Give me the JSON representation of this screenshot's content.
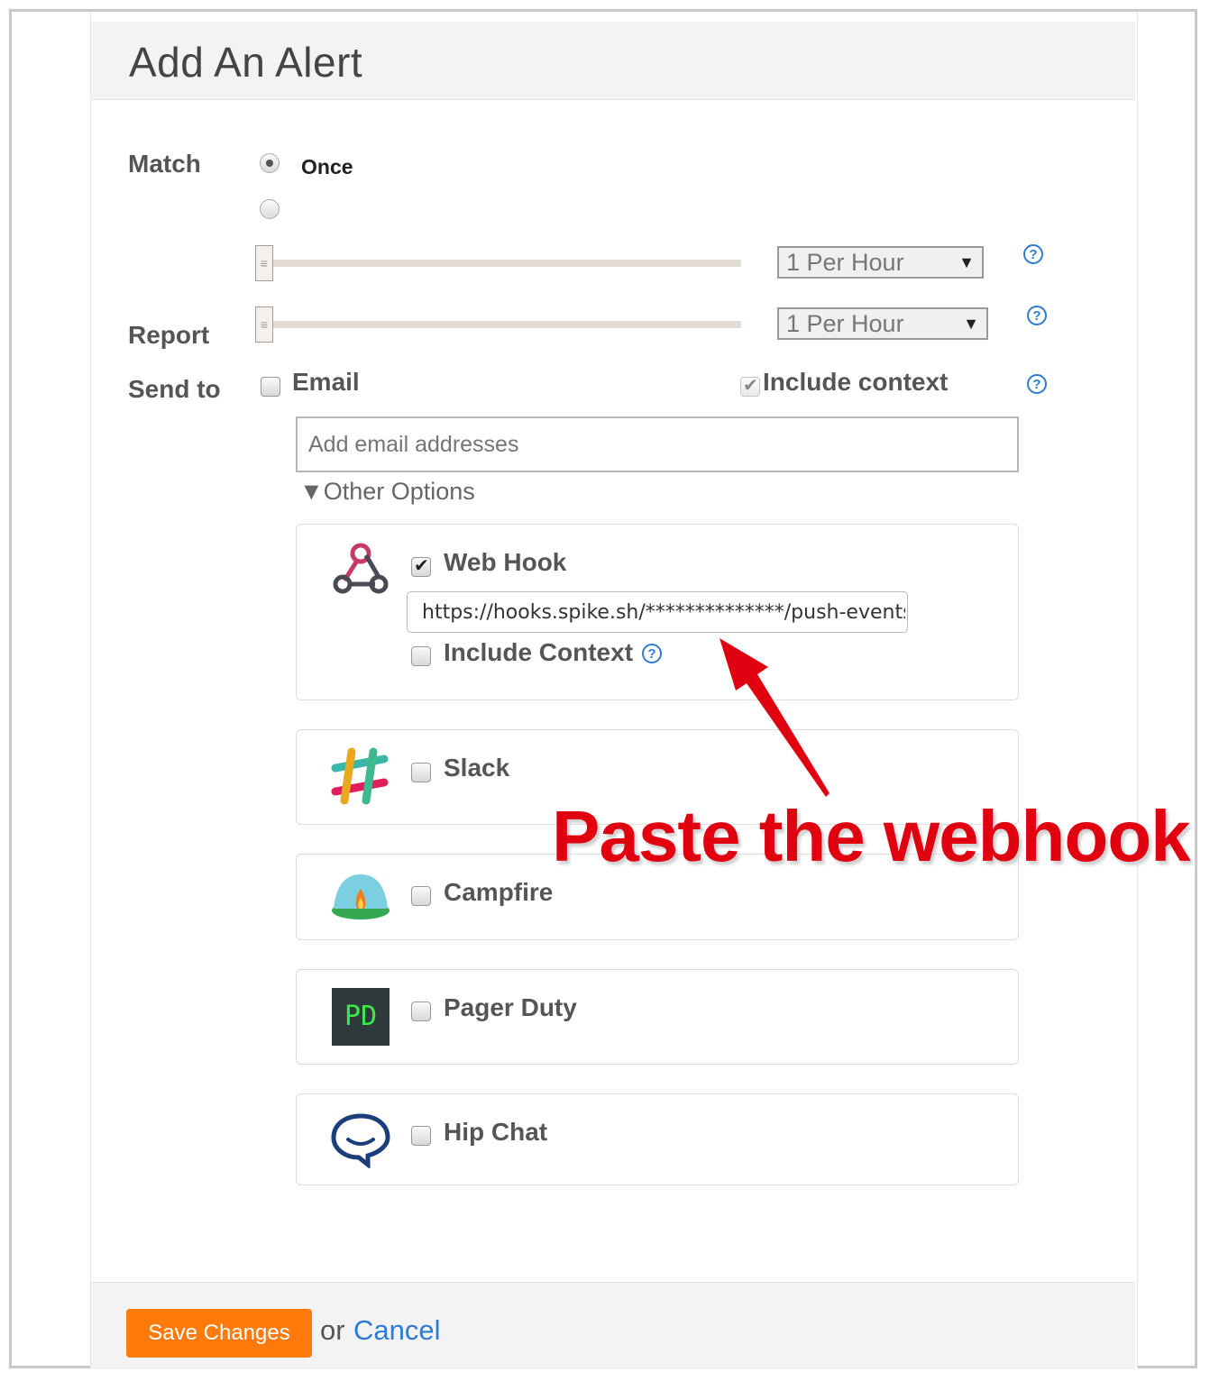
{
  "header": {
    "title": "Add An Alert"
  },
  "match": {
    "label": "Match",
    "option_once": "Once",
    "frequency_value": "1 Per Hour"
  },
  "report": {
    "label": "Report",
    "frequency_value": "1 Per Hour"
  },
  "send_to": {
    "label": "Send to",
    "email_label": "Email",
    "include_context_label": "Include context",
    "email_placeholder": "Add email addresses",
    "other_options": "Other Options"
  },
  "integrations": {
    "webhook": {
      "label": "Web Hook",
      "url_value": "https://hooks.spike.sh/**************/push-events",
      "include_context_label": "Include Context",
      "checked": true
    },
    "slack": {
      "label": "Slack",
      "checked": false
    },
    "campfire": {
      "label": "Campfire",
      "checked": false
    },
    "pagerduty": {
      "label": "Pager Duty",
      "icon_text": "PD",
      "checked": false
    },
    "hipchat": {
      "label": "Hip Chat",
      "checked": false
    }
  },
  "footer": {
    "save_label": "Save Changes",
    "or_text": "or",
    "cancel_label": "Cancel"
  },
  "annotation": {
    "text": "Paste the webhook"
  },
  "colors": {
    "accent_orange": "#ff7a0a",
    "link_blue": "#2e7bd1",
    "annotation_red": "#e00010"
  }
}
